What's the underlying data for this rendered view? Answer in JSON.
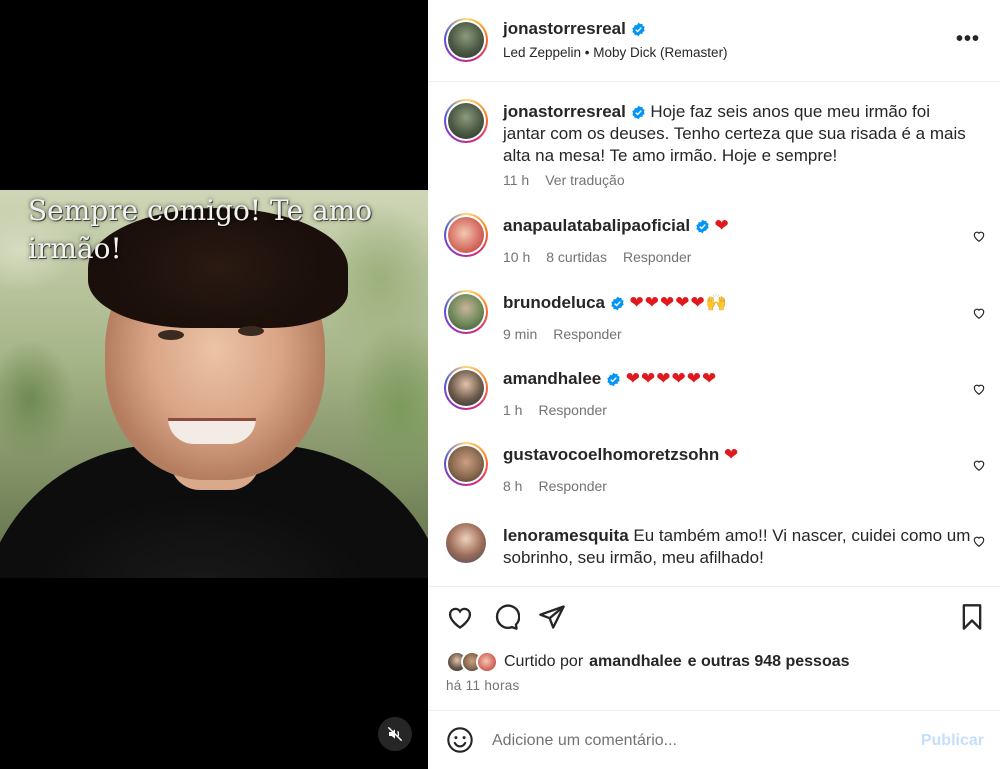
{
  "media": {
    "caption_overlay": "Sempre comigo! Te amo irmão!",
    "mute_icon": "speaker-muted-icon"
  },
  "header": {
    "username": "jonastorresreal",
    "verified": true,
    "music": "Led Zeppelin • Moby Dick (Remaster)",
    "more_label": "•••"
  },
  "post_caption": {
    "username": "jonastorresreal",
    "text": "Hoje faz seis anos que meu irmão foi jantar com os deuses. Tenho certeza que sua risada é a mais alta na mesa! Te amo irmão. Hoje e sempre!",
    "time": "11 h",
    "translate": "Ver tradução"
  },
  "comments": [
    {
      "username": "anapaulatabalipaoficial",
      "verified": true,
      "text": "❤",
      "time": "10 h",
      "likes": "8 curtidas",
      "reply": "Responder"
    },
    {
      "username": "brunodeluca",
      "verified": true,
      "text": "❤❤❤❤❤🙌",
      "time": "9 min",
      "likes": "",
      "reply": "Responder"
    },
    {
      "username": "amandhalee",
      "verified": true,
      "text": "❤❤❤❤❤❤",
      "time": "1 h",
      "likes": "",
      "reply": "Responder"
    },
    {
      "username": "gustavocoelhomoretzsohn",
      "verified": false,
      "text": "❤",
      "time": "8 h",
      "likes": "",
      "reply": "Responder"
    },
    {
      "username": "lenoramesquita",
      "verified": false,
      "text": "Eu também amo!! Vi nascer, cuidei como um sobrinho, seu irmão, meu afilhado!",
      "time": "",
      "likes": "",
      "reply": ""
    }
  ],
  "actions": {
    "liked_prefix": "Curtido por",
    "liked_user": "amandhalee",
    "liked_suffix": "e outras 948 pessoas",
    "time_ago": "há 11 horas"
  },
  "add_comment": {
    "placeholder": "Adicione um comentário...",
    "publish_label": "Publicar"
  },
  "colors": {
    "verified_blue": "#0095f6",
    "heart_red": "#e0191e",
    "secondary_text": "#737373",
    "publish_disabled": "#c4dffc"
  }
}
